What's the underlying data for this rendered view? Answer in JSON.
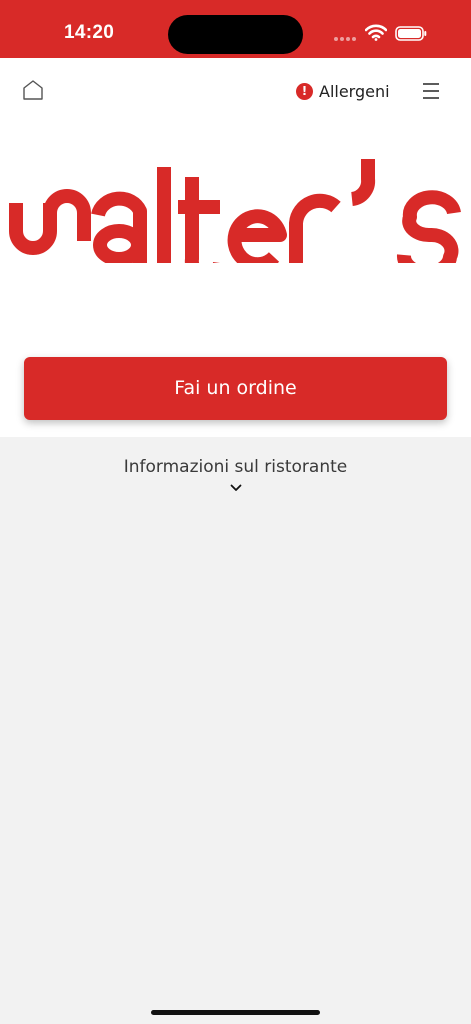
{
  "status_bar": {
    "time": "14:20",
    "background": "#d82a28"
  },
  "header": {
    "home_icon": "home-icon",
    "allergens_label": "Allergeni",
    "allergens_icon": "exclamation-circle-icon",
    "menu_icon": "hamburger-menu-icon"
  },
  "logo": {
    "text": "walter's",
    "color": "#d82a28"
  },
  "order_button": {
    "label": "Fai un ordine",
    "color": "#d82a28"
  },
  "info": {
    "title": "Informazioni sul ristorante",
    "chevron_icon": "chevron-down-icon"
  },
  "colors": {
    "brand_red": "#d82a28",
    "page_background": "#f2f2f2",
    "card_background": "#ffffff"
  }
}
